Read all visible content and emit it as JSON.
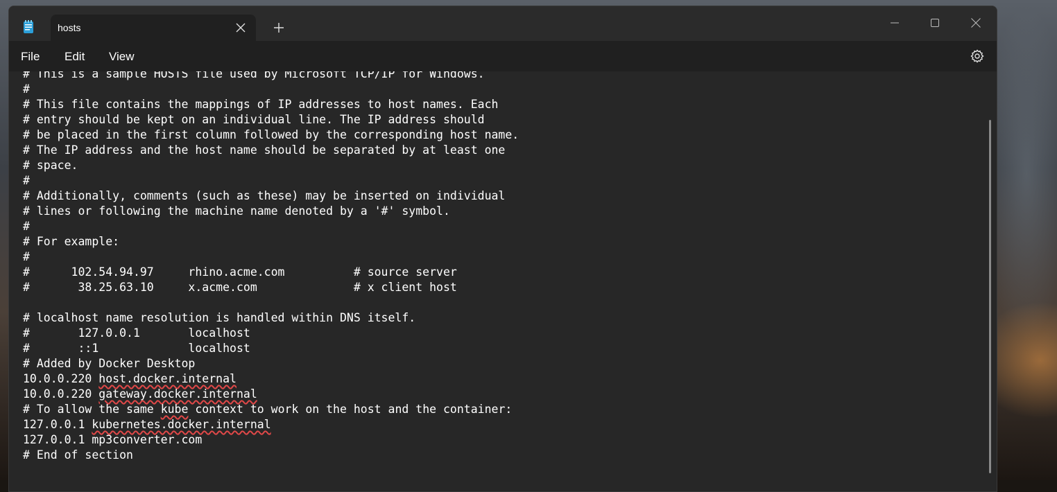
{
  "window": {
    "tab_title": "hosts",
    "new_tab_symbol": "+",
    "icons": {
      "app": "notepad-icon",
      "close_tab": "close-icon",
      "new_tab": "plus-icon",
      "minimize": "minimize-icon",
      "maximize": "maximize-icon",
      "close_window": "close-icon",
      "settings": "gear-icon"
    }
  },
  "menu": {
    "file": "File",
    "edit": "Edit",
    "view": "View"
  },
  "editor": {
    "lines": [
      "# This is a sample HOSTS file used by Microsoft TCP/IP for Windows.",
      "#",
      "# This file contains the mappings of IP addresses to host names. Each",
      "# entry should be kept on an individual line. The IP address should",
      "# be placed in the first column followed by the corresponding host name.",
      "# The IP address and the host name should be separated by at least one",
      "# space.",
      "#",
      "# Additionally, comments (such as these) may be inserted on individual",
      "# lines or following the machine name denoted by a '#' symbol.",
      "#",
      "# For example:",
      "#",
      "#      102.54.94.97     rhino.acme.com          # source server",
      "#       38.25.63.10     x.acme.com              # x client host",
      "",
      "# localhost name resolution is handled within DNS itself.",
      "#       127.0.0.1       localhost",
      "#       ::1             localhost",
      "# Added by Docker Desktop",
      "10.0.0.220 host.docker.internal",
      "10.0.0.220 gateway.docker.internal",
      "# To allow the same kube context to work on the host and the container:",
      "127.0.0.1 kubernetes.docker.internal",
      "127.0.0.1 mp3converter.com",
      "# End of section"
    ],
    "spellcheck_flagged": [
      "host.docker.internal",
      "gateway.docker.internal",
      "kube",
      "kubernetes.docker.internal"
    ]
  },
  "colors": {
    "titlebar": "#2b2b2b",
    "editor_bg": "#272727",
    "text": "#ffffff",
    "spellcheck": "#e04848"
  }
}
